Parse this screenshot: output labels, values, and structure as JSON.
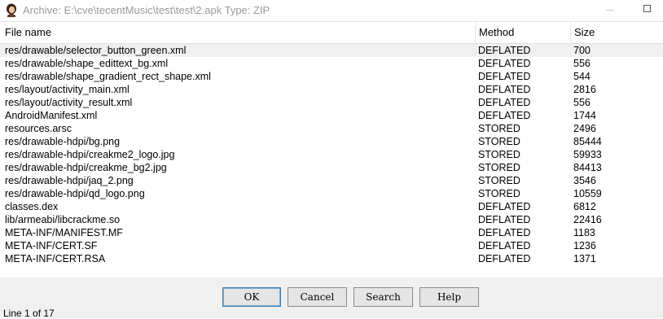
{
  "window": {
    "title": "Archive: E:\\cve\\tecentMusic\\test\\test\\2.apk Type: ZIP"
  },
  "table": {
    "columns": [
      "File name",
      "Method",
      "Size"
    ],
    "rows": [
      {
        "name": "res/drawable/selector_button_green.xml",
        "method": "DEFLATED",
        "size": "700"
      },
      {
        "name": "res/drawable/shape_edittext_bg.xml",
        "method": "DEFLATED",
        "size": "556"
      },
      {
        "name": "res/drawable/shape_gradient_rect_shape.xml",
        "method": "DEFLATED",
        "size": "544"
      },
      {
        "name": "res/layout/activity_main.xml",
        "method": "DEFLATED",
        "size": "2816"
      },
      {
        "name": "res/layout/activity_result.xml",
        "method": "DEFLATED",
        "size": "556"
      },
      {
        "name": "AndroidManifest.xml",
        "method": "DEFLATED",
        "size": "1744"
      },
      {
        "name": "resources.arsc",
        "method": "STORED",
        "size": "2496"
      },
      {
        "name": "res/drawable-hdpi/bg.png",
        "method": "STORED",
        "size": "85444"
      },
      {
        "name": "res/drawable-hdpi/creakme2_logo.jpg",
        "method": "STORED",
        "size": "59933"
      },
      {
        "name": "res/drawable-hdpi/creakme_bg2.jpg",
        "method": "STORED",
        "size": "84413"
      },
      {
        "name": "res/drawable-hdpi/jaq_2.png",
        "method": "STORED",
        "size": "3546"
      },
      {
        "name": "res/drawable-hdpi/qd_logo.png",
        "method": "STORED",
        "size": "10559"
      },
      {
        "name": "classes.dex",
        "method": "DEFLATED",
        "size": "6812"
      },
      {
        "name": "lib/armeabi/libcrackme.so",
        "method": "DEFLATED",
        "size": "22416"
      },
      {
        "name": "META-INF/MANIFEST.MF",
        "method": "DEFLATED",
        "size": "1183"
      },
      {
        "name": "META-INF/CERT.SF",
        "method": "DEFLATED",
        "size": "1236"
      },
      {
        "name": "META-INF/CERT.RSA",
        "method": "DEFLATED",
        "size": "1371"
      }
    ],
    "selected_row": 0
  },
  "buttons": {
    "ok": "OK",
    "cancel": "Cancel",
    "search": "Search",
    "help": "Help"
  },
  "status": "Line 1 of 17"
}
